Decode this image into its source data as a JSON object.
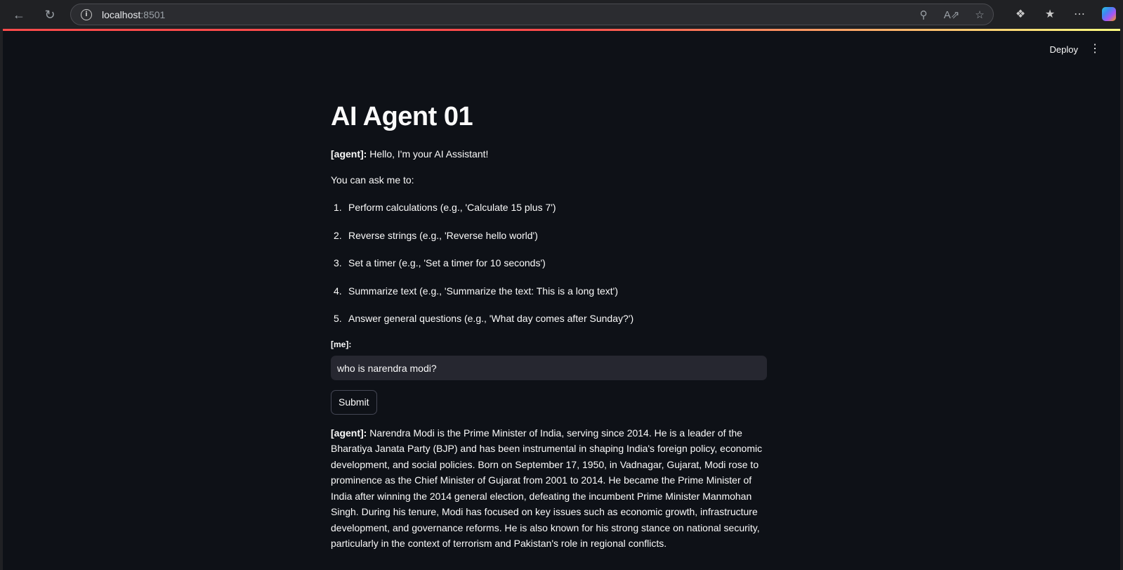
{
  "browser": {
    "url_host": "localhost",
    "url_port": ":8501"
  },
  "app": {
    "deploy_label": "Deploy",
    "title": "AI Agent 01",
    "greeting_prefix": "[agent]:",
    "greeting_text": " Hello, I'm your AI Assistant!",
    "intro": "You can ask me to:",
    "items": [
      {
        "num": "1.",
        "text": "Perform calculations (e.g., 'Calculate 15 plus 7')"
      },
      {
        "num": "2.",
        "text": "Reverse strings (e.g., 'Reverse hello world')"
      },
      {
        "num": "3.",
        "text": "Set a timer (e.g., 'Set a timer for 10 seconds')"
      },
      {
        "num": "4.",
        "text": "Summarize text (e.g., 'Summarize the text: This is a long text')"
      },
      {
        "num": "5.",
        "text": "Answer general questions (e.g., 'What day comes after Sunday?')"
      }
    ],
    "me_label": "[me]:",
    "input_value": "who is narendra modi?",
    "submit_label": "Submit",
    "answer_prefix": "[agent]:",
    "answer_text": " Narendra Modi is the Prime Minister of India, serving since 2014. He is a leader of the Bharatiya Janata Party (BJP) and has been instrumental in shaping India's foreign policy, economic development, and social policies. Born on September 17, 1950, in Vadnagar, Gujarat, Modi rose to prominence as the Chief Minister of Gujarat from 2001 to 2014. He became the Prime Minister of India after winning the 2014 general election, defeating the incumbent Prime Minister Manmohan Singh. During his tenure, Modi has focused on key issues such as economic growth, infrastructure development, and governance reforms. He is also known for his strong stance on national security, particularly in the context of terrorism and Pakistan's role in regional conflicts."
  },
  "colors": {
    "app_bg": "#0e1117",
    "input_bg": "#262730",
    "accent_red": "#ff4b4b",
    "text": "#fafafa"
  }
}
